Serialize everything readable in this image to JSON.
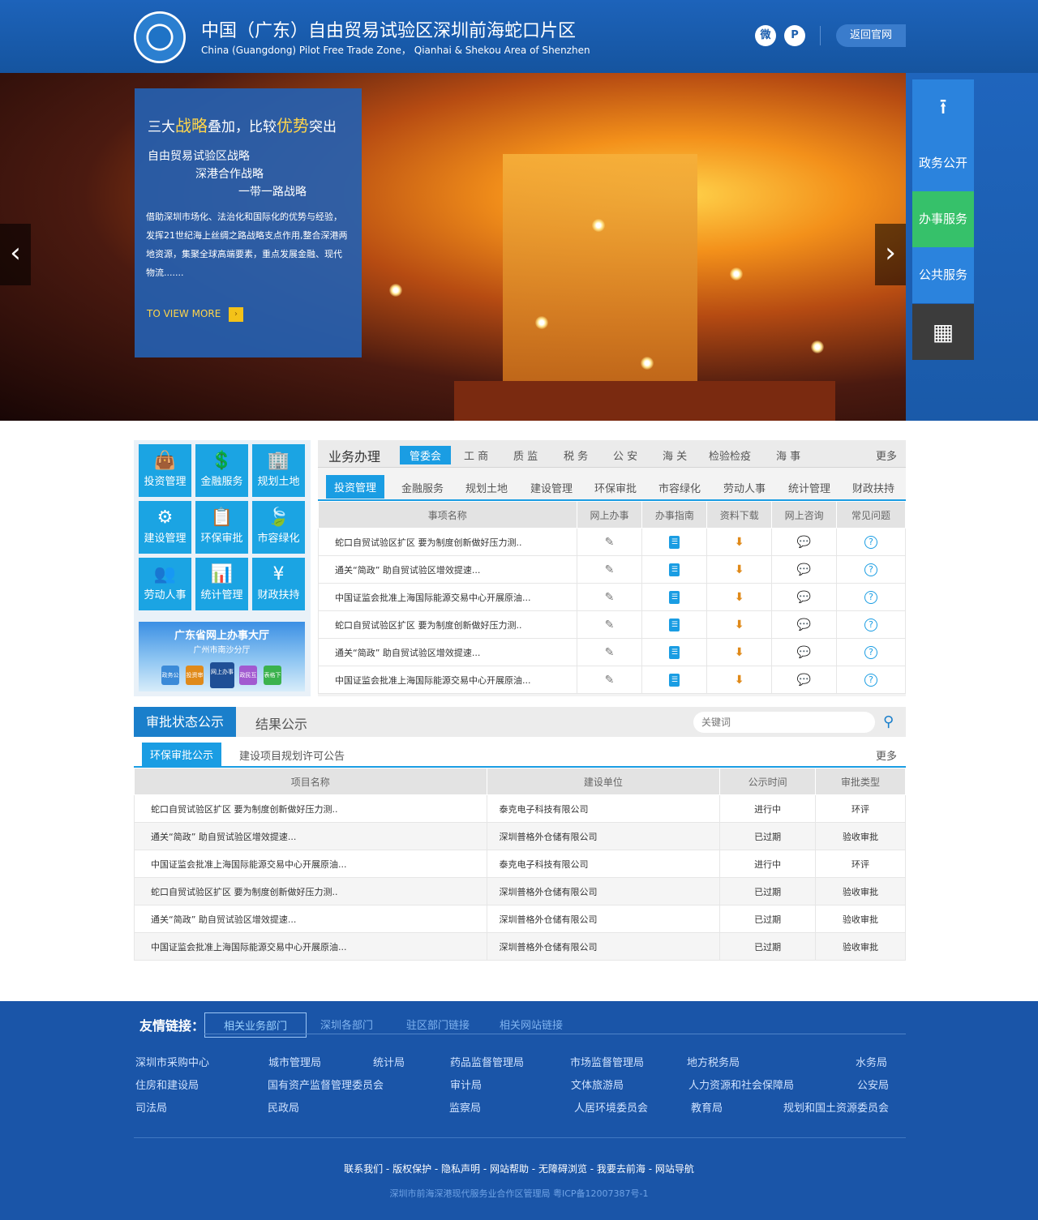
{
  "header": {
    "title": "中国（广东）自由贸易试验区深圳前海蛇口片区",
    "subtitle": "China (Guangdong) Pilot Free Trade Zone， Qianhai & Shekou Area of Shenzhen",
    "back_label": "返回官网",
    "weibo": "微",
    "other": "P"
  },
  "banner": {
    "headline_a": "三大",
    "headline_b": "战略",
    "headline_c": "叠加，比较",
    "headline_d": "优势",
    "headline_e": "突出",
    "lines": [
      "自由贸易试验区战略",
      "深港合作战略",
      "一带一路战略"
    ],
    "desc": "借助深圳市场化、法治化和国际化的优势与经验，发挥21世纪海上丝绸之路战略支点作用,整合深港两地资源，集聚全球高端要素，重点发展金融、现代物流.......",
    "more": "TO VIEW MORE",
    "more_icon": "›",
    "prev": "‹",
    "next": "›"
  },
  "side_nav": {
    "top_icon": "⭱",
    "items": [
      "政务公开",
      "办事服务",
      "公共服务"
    ],
    "qr_icon": "▦"
  },
  "tiles": [
    {
      "icon": "👜",
      "label": "投资管理"
    },
    {
      "icon": "💲",
      "label": "金融服务"
    },
    {
      "icon": "🏢",
      "label": "规划土地"
    },
    {
      "icon": "⚙",
      "label": "建设管理"
    },
    {
      "icon": "📋",
      "label": "环保审批"
    },
    {
      "icon": "🍃",
      "label": "市容绿化"
    },
    {
      "icon": "👥",
      "label": "劳动人事"
    },
    {
      "icon": "📊",
      "label": "统计管理"
    },
    {
      "icon": "¥",
      "label": "财政扶持"
    }
  ],
  "ad": {
    "title": "广东省网上办事大厅",
    "subtitle": "广州市南沙分厅",
    "figs": [
      "政务公开",
      "投资审批",
      "网上办事",
      "政民互动",
      "表格下载"
    ]
  },
  "business": {
    "title": "业务办理",
    "categories": [
      "管委会",
      "工 商",
      "质 监",
      "税 务",
      "公 安",
      "海 关",
      "检验检疫",
      "海 事"
    ],
    "more": "更多",
    "subtabs": [
      "投资管理",
      "金融服务",
      "规划土地",
      "建设管理",
      "环保审批",
      "市容绿化",
      "劳动人事",
      "统计管理",
      "财政扶持"
    ],
    "columns": [
      "事项名称",
      "网上办事",
      "办事指南",
      "资料下载",
      "网上咨询",
      "常见问题"
    ],
    "rows": [
      "蛇口自贸试验区扩区 要为制度创新做好压力测..",
      "通关“简政” 助自贸试验区增效提速...",
      "中国证监会批准上海国际能源交易中心开展原油...",
      "蛇口自贸试验区扩区 要为制度创新做好压力测..",
      "通关“简政” 助自贸试验区增效提速...",
      "中国证监会批准上海国际能源交易中心开展原油..."
    ],
    "icons": {
      "edit": "✎",
      "book": "☰",
      "download": "⬇",
      "chat": "💬",
      "question": "?"
    }
  },
  "approval": {
    "tab_active": "审批状态公示",
    "tab_other": "结果公示",
    "search_placeholder": "关键词",
    "search_icon": "⚲",
    "subtab_active": "环保审批公示",
    "subtab_other": "建设项目规划许可公告",
    "more": "更多",
    "columns": [
      "项目名称",
      "建设单位",
      "公示时间",
      "审批类型"
    ],
    "rows": [
      [
        "蛇口自贸试验区扩区 要为制度创新做好压力测..",
        "泰克电子科技有限公司",
        "进行中",
        "环评"
      ],
      [
        "通关“简政” 助自贸试验区增效提速...",
        "深圳普格外仓储有限公司",
        "已过期",
        "验收审批"
      ],
      [
        "中国证监会批准上海国际能源交易中心开展原油...",
        "泰克电子科技有限公司",
        "进行中",
        "环评"
      ],
      [
        "蛇口自贸试验区扩区 要为制度创新做好压力测..",
        "深圳普格外仓储有限公司",
        "已过期",
        "验收审批"
      ],
      [
        "通关“简政” 助自贸试验区增效提速...",
        "深圳普格外仓储有限公司",
        "已过期",
        "验收审批"
      ],
      [
        "中国证监会批准上海国际能源交易中心开展原油...",
        "深圳普格外仓储有限公司",
        "已过期",
        "验收审批"
      ]
    ]
  },
  "footer": {
    "label": "友情链接：",
    "tabs": [
      "相关业务部门",
      "深圳各部门",
      "驻区部门链接",
      "相关网站链接"
    ],
    "links": [
      "深圳市采购中心",
      "城市管理局",
      "统计局",
      "药品监督管理局",
      "市场监督管理局",
      "地方税务局",
      "水务局",
      "住房和建设局",
      "国有资产监督管理委员会",
      "审计局",
      "文体旅游局",
      "人力资源和社会保障局",
      "公安局",
      "司法局",
      "民政局",
      "监察局",
      "人居环境委员会",
      "教育局",
      "规划和国土资源委员会"
    ],
    "bottom_links": "联系我们 - 版权保护 - 隐私声明 - 网站帮助 - 无障碍浏览 - 我要去前海 - 网站导航",
    "copyright": "深圳市前海深港现代服务业合作区管理局   粤ICP备12007387号-1"
  }
}
